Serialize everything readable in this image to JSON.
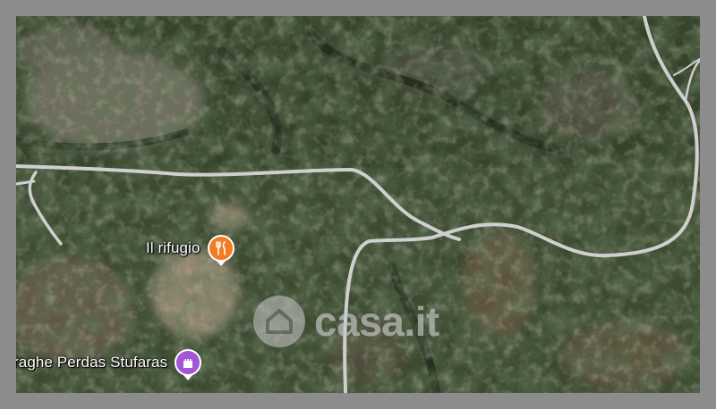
{
  "map": {
    "pois": [
      {
        "label": "Il rifugio",
        "icon": "restaurant-icon",
        "color": "#f37c22"
      },
      {
        "label": "raghe Perdas Stufaras",
        "icon": "castle-icon",
        "color": "#a257d6"
      }
    ]
  },
  "watermark": {
    "text": "casa.it",
    "icon": "house-icon"
  },
  "colors": {
    "frame": "#8c8c8c",
    "road": "#c9c9c9",
    "vegetation": "#3a4a2e"
  }
}
